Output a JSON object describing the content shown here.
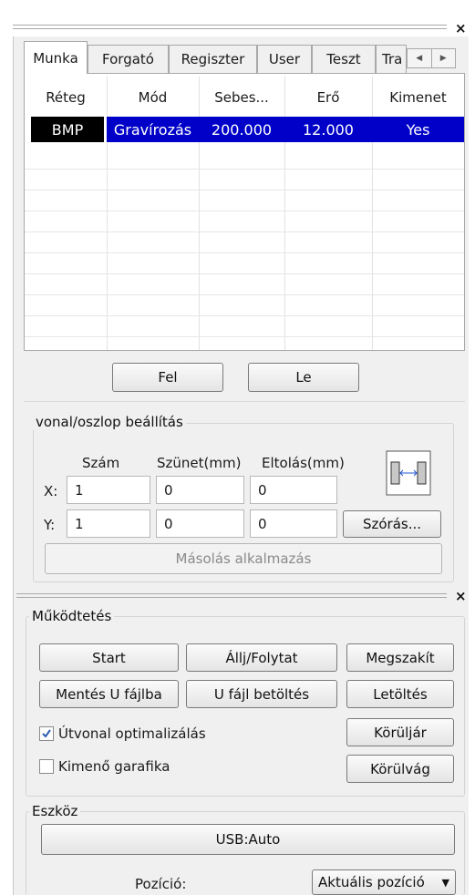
{
  "tabs": [
    "Munka",
    "Forgató",
    "Regiszter",
    "User",
    "Teszt",
    "Tra"
  ],
  "scroll_left_icon": "arrow-left-icon",
  "scroll_right_icon": "arrow-right-icon",
  "close_icon": "close-icon",
  "table": {
    "headers": [
      "Réteg",
      "Mód",
      "Sebes...",
      "Erő",
      "Kimenet"
    ],
    "rows": [
      {
        "layer": "BMP",
        "mode": "Gravírozás",
        "speed": "200.000",
        "power": "12.000",
        "output": "Yes",
        "layer_color": "#000000"
      }
    ],
    "selected_color": "#0000c8"
  },
  "buttons_updown": {
    "up": "Fel",
    "down": "Le"
  },
  "array": {
    "title": "vonal/oszlop beállítás",
    "col_count": "Szám",
    "col_gap": "Szünet(mm)",
    "col_offset": "Eltolás(mm)",
    "x_label": "X:",
    "y_label": "Y:",
    "x_count": "1",
    "x_gap": "0",
    "x_offset": "0",
    "y_count": "1",
    "y_gap": "0",
    "y_offset": "0",
    "scatter_button": "Szórás...",
    "apply_button": "Másolás alkalmazás"
  },
  "operation": {
    "title": "Működtetés",
    "start": "Start",
    "pause": "Állj/Folytat",
    "stop": "Megszakít",
    "save_u": "Mentés U fájlba",
    "load_u": "U fájl betöltés",
    "download": "Letöltés",
    "frame": "Körüljár",
    "frame_cut": "Körülvág",
    "opt_path": "Útvonal optimalizálás",
    "opt_path_checked": true,
    "output_graphics": "Kimenő garafika",
    "output_graphics_checked": false
  },
  "device": {
    "title": "Eszköz",
    "usb_button": "USB:Auto",
    "position_label": "Pozíció:",
    "position_select": "Aktuális pozíció"
  }
}
